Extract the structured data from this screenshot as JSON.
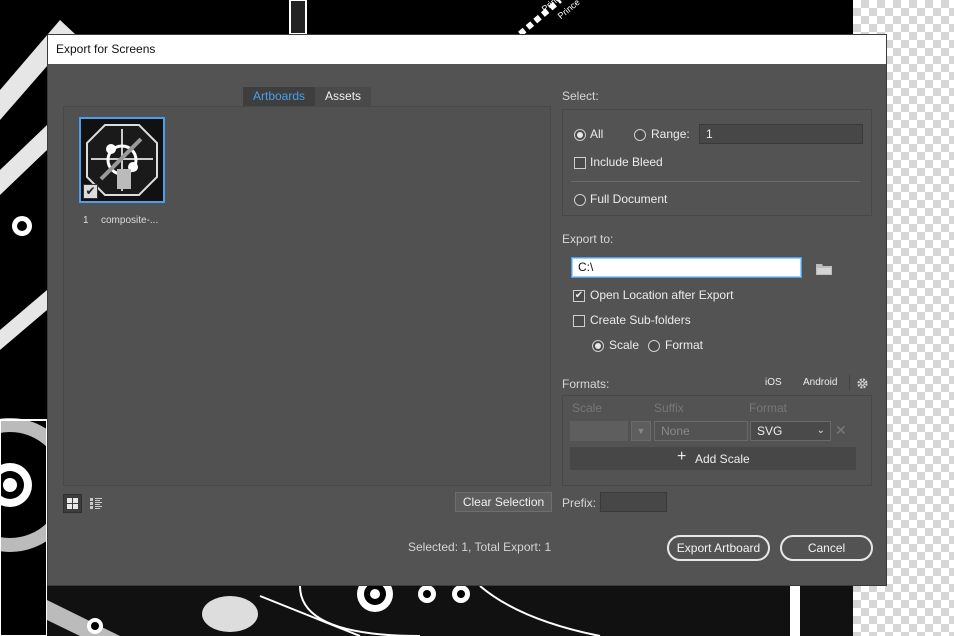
{
  "canvas": {
    "art_text_1": "Prince",
    "art_text_2": "Prince"
  },
  "dialog": {
    "title": "Export for Screens",
    "tabs": [
      {
        "label": "Artboards",
        "active": true
      },
      {
        "label": "Assets",
        "active": false
      }
    ],
    "artboard": {
      "number": "1",
      "name": "composite-...",
      "checked": true
    },
    "clear_selection_label": "Clear Selection",
    "prefix_label": "Prefix:",
    "prefix_value": "",
    "status_text": "Selected: 1, Total Export: 1",
    "export_button_label": "Export Artboard",
    "cancel_button_label": "Cancel"
  },
  "select": {
    "heading": "Select:",
    "all_label": "All",
    "all_selected": true,
    "range_label": "Range:",
    "range_value": "1",
    "include_bleed_label": "Include Bleed",
    "include_bleed_checked": false,
    "full_document_label": "Full Document"
  },
  "export_to": {
    "heading": "Export to:",
    "path_value": "C:\\",
    "open_location_label": "Open Location after Export",
    "open_location_checked": true,
    "subfolders_label": "Create Sub-folders",
    "subfolders_checked": false,
    "scale_label": "Scale",
    "format_label": "Format",
    "scale_selected": true
  },
  "formats": {
    "heading": "Formats:",
    "ios_label": "iOS",
    "android_label": "Android",
    "columns": {
      "scale": "Scale",
      "suffix": "Suffix",
      "format": "Format"
    },
    "row": {
      "scale": "",
      "suffix_placeholder": "None",
      "format": "SVG"
    },
    "add_scale_label": "Add Scale"
  },
  "colors": {
    "accent": "#4a9fe8",
    "dialog_bg": "#535353"
  }
}
